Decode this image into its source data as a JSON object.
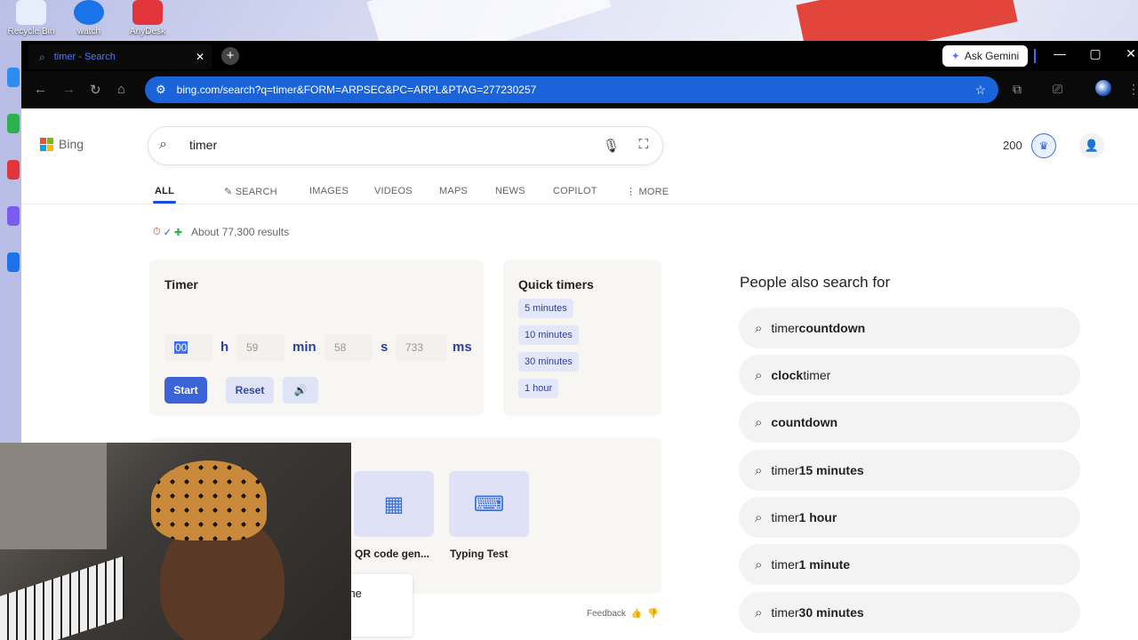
{
  "desktop": {
    "icons": [
      {
        "label": "Recycle Bin",
        "color": "#3a7bd5"
      },
      {
        "label": "watch",
        "color": "#1a73e8"
      },
      {
        "label": "AnyDesk",
        "color": "#e2343b"
      }
    ]
  },
  "browser": {
    "tab": {
      "title": "timer - Search",
      "icon": "bing-favicon"
    },
    "ask_gemini": "Ask Gemini",
    "address": "bing.com/search?q=timer&FORM=ARPSEC&PC=ARPL&PTAG=277230257"
  },
  "bing": {
    "brand": "Bing",
    "query": "timer",
    "points": "200",
    "nav": [
      "ALL",
      "SEARCH",
      "IMAGES",
      "VIDEOS",
      "MAPS",
      "NEWS",
      "COPILOT",
      "MORE"
    ],
    "results_count": "About 77,300 results",
    "timer": {
      "title": "Timer",
      "hours": "00",
      "minutes": "59",
      "seconds": "58",
      "milliseconds": "733",
      "units": {
        "h": "h",
        "min": "min",
        "s": "s",
        "ms": "ms"
      },
      "start_label": "Start",
      "reset_label": "Reset"
    },
    "quick_timers": {
      "title": "Quick timers",
      "items": [
        "5 minutes",
        "10 minutes",
        "30 minutes",
        "1 hour"
      ]
    },
    "tools": [
      {
        "name": "QR code gen...",
        "icon": "qr-code-icon"
      },
      {
        "name": "Typing Test",
        "icon": "keyboard-icon"
      }
    ],
    "tooltip_fragment": "n the",
    "feedback": "Feedback",
    "people_also_search": {
      "title": "People also search for",
      "items": [
        {
          "normal": "timer ",
          "bold": "countdown"
        },
        {
          "bold": "clock",
          "normal": " timer"
        },
        {
          "bold": "countdown",
          "normal": ""
        },
        {
          "normal": "timer ",
          "bold": "15 minutes"
        },
        {
          "normal": "timer ",
          "bold": "1 hour"
        },
        {
          "normal": "timer ",
          "bold": "1 minute"
        },
        {
          "normal": "timer ",
          "bold": "30 minutes"
        }
      ]
    }
  },
  "colors": {
    "accent": "#3d63d8",
    "omnibox": "#1b63d9",
    "brand_blue": "#174ae4"
  }
}
